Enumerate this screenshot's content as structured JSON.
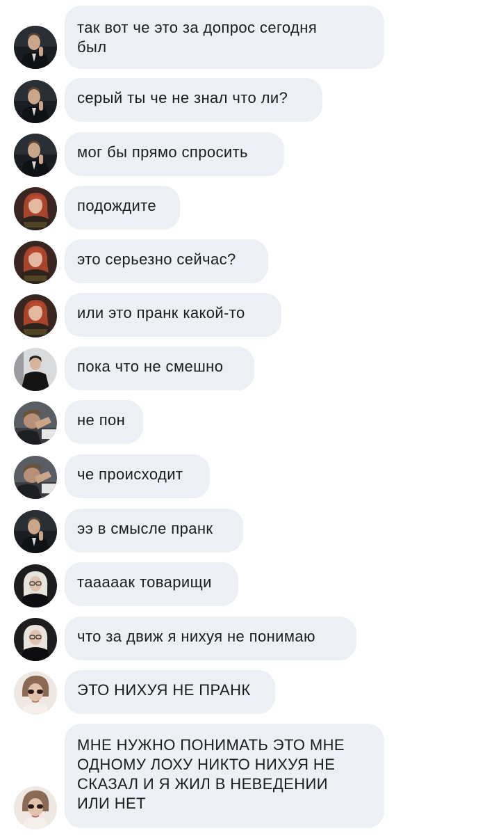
{
  "messages": [
    {
      "text": "так вот че это за допрос сегодня\nбыл",
      "avatar": "avatar-man-suit"
    },
    {
      "text": "серый ты че не знал что ли?",
      "avatar": "avatar-man-suit"
    },
    {
      "text": "мог бы прямо спросить",
      "avatar": "avatar-man-suit"
    },
    {
      "text": "подождите",
      "avatar": "avatar-woman-redhair"
    },
    {
      "text": "это серьезно сейчас?",
      "avatar": "avatar-woman-redhair"
    },
    {
      "text": "или это пранк какой-то",
      "avatar": "avatar-woman-redhair"
    },
    {
      "text": "пока что не смешно",
      "avatar": "avatar-man-black-jacket"
    },
    {
      "text": "не пон",
      "avatar": "avatar-man-hand-face"
    },
    {
      "text": "че происходит",
      "avatar": "avatar-man-hand-face"
    },
    {
      "text": "ээ в смысле пранк",
      "avatar": "avatar-man-suit"
    },
    {
      "text": "тааааак товарищи",
      "avatar": "avatar-woman-blonde-glasses"
    },
    {
      "text": "что за движ я нихуя не понимаю",
      "avatar": "avatar-woman-blonde-glasses"
    },
    {
      "text": "ЭТО НИХУЯ НЕ ПРАНК",
      "avatar": "avatar-man-sunglasses"
    },
    {
      "text": "МНЕ НУЖНО ПОНИМАТЬ ЭТО МНЕ\nОДНОМУ ЛОХУ НИКТО НИХУЯ НЕ\nСКАЗАЛ И Я ЖИЛ В НЕВЕДЕНИИ\nИЛИ НЕТ",
      "avatar": "avatar-man-sunglasses"
    }
  ]
}
